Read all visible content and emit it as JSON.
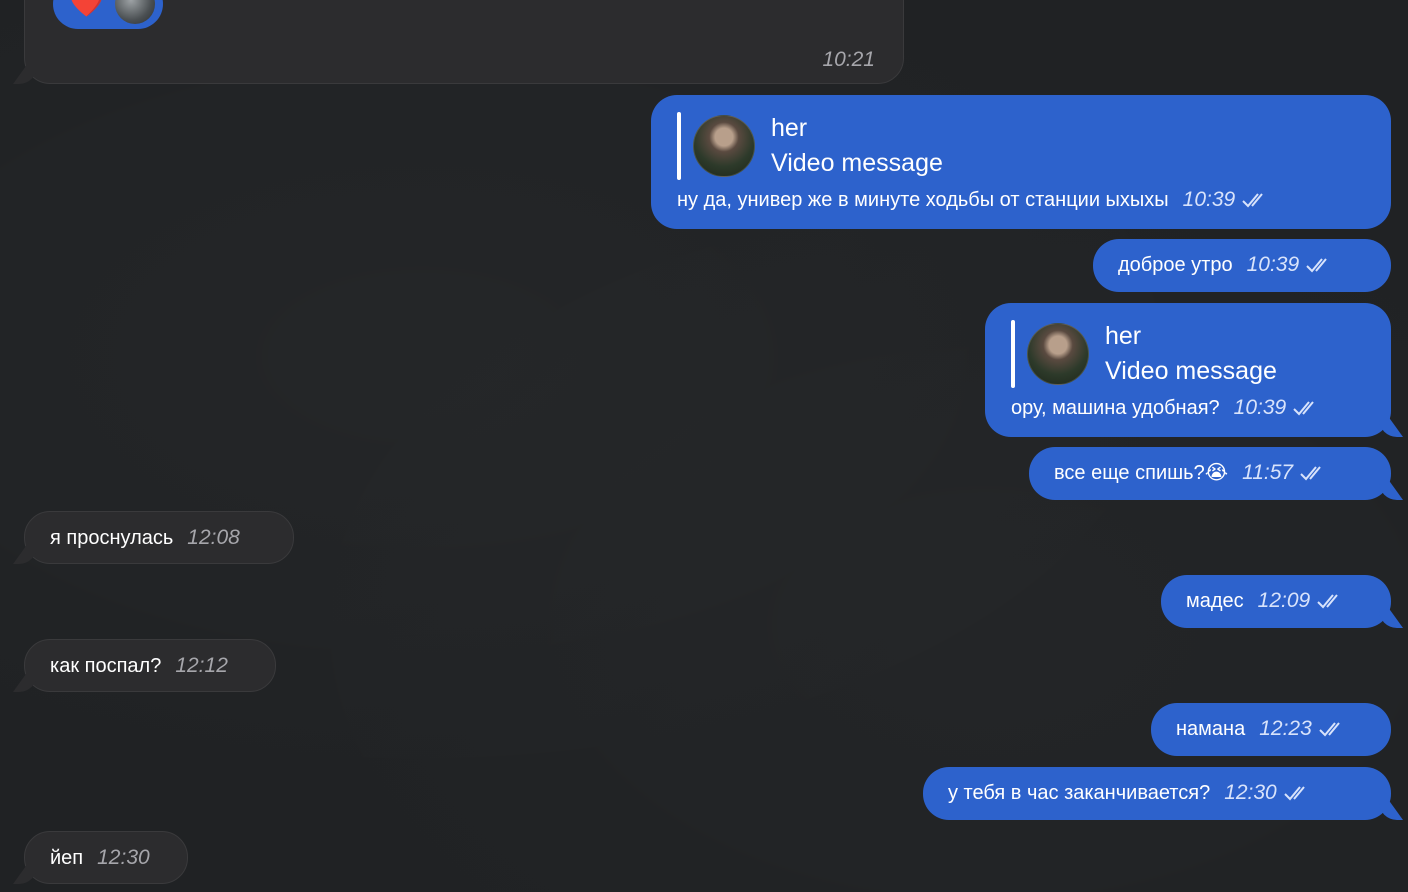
{
  "colors": {
    "background": "#202224",
    "incoming_bubble": "#2c2c2e",
    "outgoing_bubble": "#2d62cc"
  },
  "messages": [
    {
      "dir": "in",
      "text": "",
      "time": "10:21",
      "reaction": "❤️"
    },
    {
      "dir": "out",
      "reply_name": "her",
      "reply_text": "Video message",
      "text": "ну да, универ же в минуте ходьбы от станции ыхыхы",
      "time": "10:39"
    },
    {
      "dir": "out",
      "text": "доброе утро",
      "time": "10:39"
    },
    {
      "dir": "out",
      "reply_name": "her",
      "reply_text": "Video message",
      "text": "ору, машина удобная?",
      "time": "10:39"
    },
    {
      "dir": "out",
      "text": "все еще спишь?😭",
      "time": "11:57"
    },
    {
      "dir": "in",
      "text": "я проснулась",
      "time": "12:08"
    },
    {
      "dir": "out",
      "text": "мадес",
      "time": "12:09"
    },
    {
      "dir": "in",
      "text": "как поспал?",
      "time": "12:12"
    },
    {
      "dir": "out",
      "text": "намана",
      "time": "12:23"
    },
    {
      "dir": "out",
      "text": "у тебя в час заканчивается?",
      "time": "12:30"
    },
    {
      "dir": "in",
      "text": "йеп",
      "time": "12:30"
    }
  ]
}
